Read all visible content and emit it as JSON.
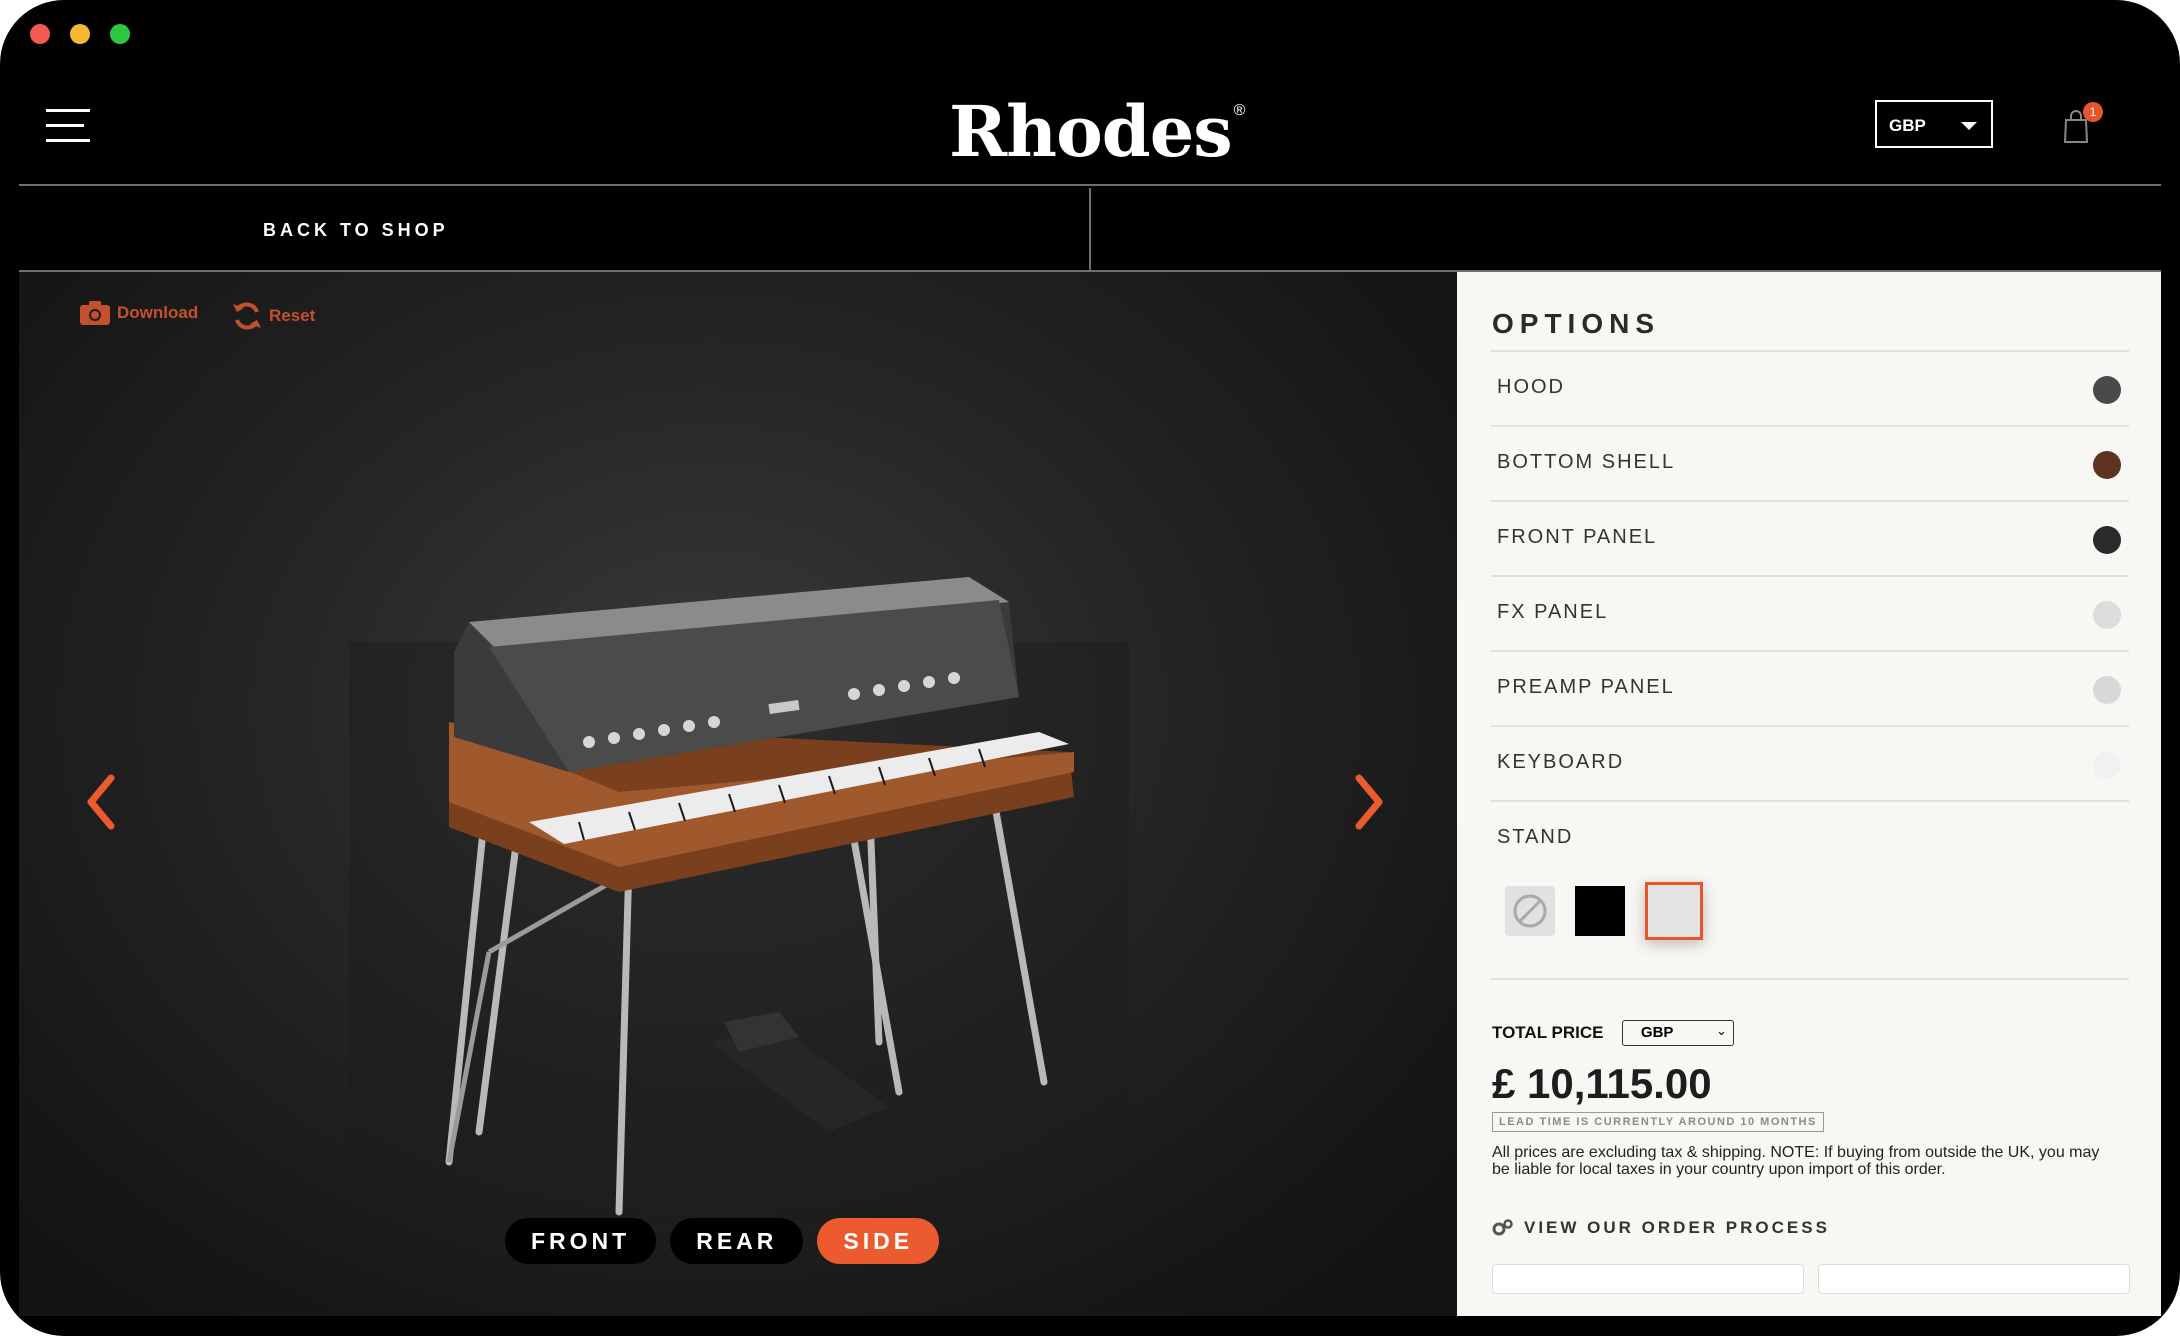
{
  "window": {
    "traffic_lights": [
      "#f05a4f",
      "#f5b82e",
      "#2bc840"
    ]
  },
  "header": {
    "logo_text": "Rhodes",
    "logo_mark": "®",
    "currency": "GBP",
    "cart_count": "1"
  },
  "subbar": {
    "back_label": "BACK TO SHOP"
  },
  "viewer": {
    "download_label": "Download",
    "reset_label": "Reset",
    "views": [
      {
        "label": "FRONT",
        "active": false
      },
      {
        "label": "REAR",
        "active": false
      },
      {
        "label": "SIDE",
        "active": true
      }
    ]
  },
  "options": {
    "title": "OPTIONS",
    "items": [
      {
        "label": "HOOD",
        "swatch": "#4a4a4a"
      },
      {
        "label": "BOTTOM SHELL",
        "swatch": "#5b3320"
      },
      {
        "label": "FRONT PANEL",
        "swatch": "#2a2a2c"
      },
      {
        "label": "FX PANEL",
        "swatch": "#dcdcdc"
      },
      {
        "label": "PREAMP PANEL",
        "swatch": "#d8d8d8"
      },
      {
        "label": "KEYBOARD",
        "swatch": "#f1f1f1"
      }
    ],
    "stand": {
      "label": "STAND",
      "swatches": [
        {
          "name": "none",
          "color": "#e1e1e1"
        },
        {
          "name": "black",
          "color": "#000000"
        },
        {
          "name": "silver",
          "color": "#e3e3e3",
          "selected": true
        }
      ]
    }
  },
  "pricing": {
    "label": "TOTAL PRICE",
    "currency": "GBP",
    "value": "£ 10,115.00",
    "lead_time": "LEAD TIME IS CURRENTLY AROUND 10 MONTHS",
    "note": "All prices are excluding tax & shipping. NOTE: If buying from outside the UK, you may be liable for local taxes in your country upon import of this order.",
    "order_process": "VIEW OUR ORDER PROCESS"
  },
  "colors": {
    "accent": "#ec5b2f",
    "tool_text": "#c5502e"
  }
}
